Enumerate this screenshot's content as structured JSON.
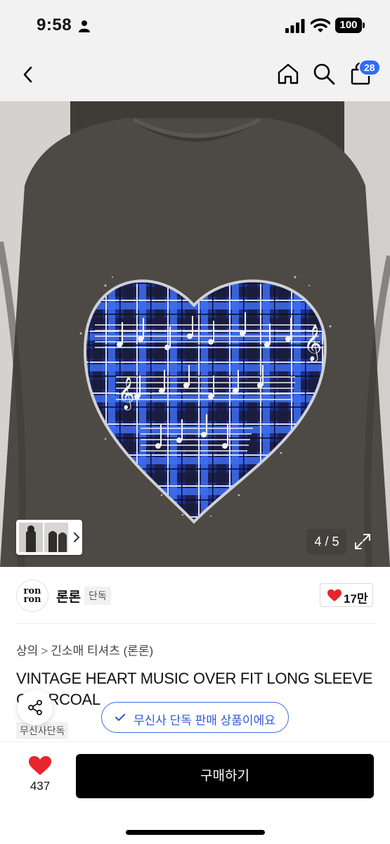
{
  "status_bar": {
    "time": "9:58",
    "battery": "100"
  },
  "nav": {
    "cart_count": "28"
  },
  "gallery": {
    "page_indicator": "4 / 5"
  },
  "brand": {
    "name": "론론",
    "logo_text": "ron ron",
    "exclusive_tag": "단독",
    "likes": "17만"
  },
  "breadcrumb": {
    "category": "상의",
    "subcategory": "긴소매 티셔츠 (론론)",
    "separator": ">"
  },
  "product": {
    "title": "VINTAGE HEART MUSIC OVER FIT LONG SLEEVE CHARCOAL",
    "tag": "무신사단독"
  },
  "toast": {
    "text": "무신사 단독 판매 상품이에요"
  },
  "bottom": {
    "wishlist_count": "437",
    "buy_label": "구매하기"
  },
  "colors": {
    "accent_blue": "#2e6bff",
    "heart_red": "#e8242c",
    "toast_blue": "#2f59d6"
  }
}
